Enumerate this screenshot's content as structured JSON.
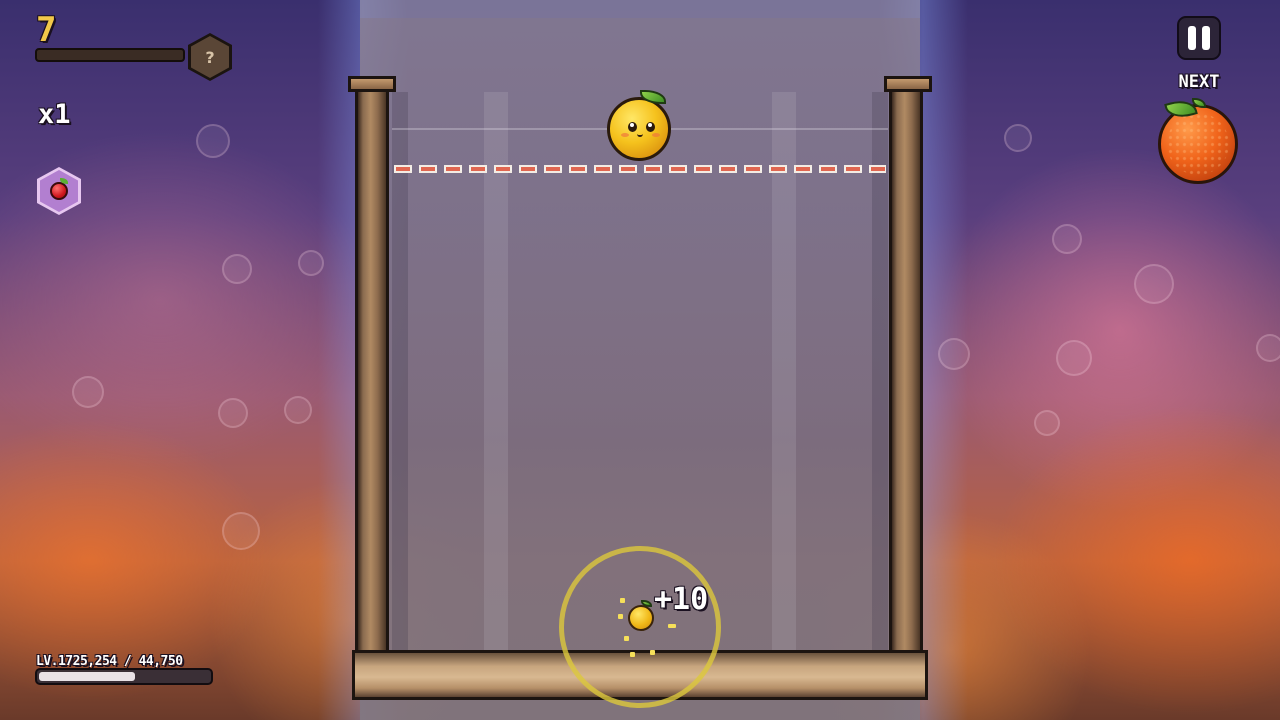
{
  "hud": {
    "score": "7",
    "score_progress": 0.0,
    "mystery_badge": "?",
    "combo": "x1",
    "powerup_icon": "apple-icon",
    "pause_icon": "pause-icon",
    "next_label": "NEXT",
    "next_fruit": "orange",
    "level_label": "LV.17",
    "level_xp": "25,254 / 44,750",
    "level_progress": 0.564
  },
  "board": {
    "current_fruit": "lemon",
    "merged_fruit": "lemon",
    "points_popup": "+10"
  },
  "colors": {
    "score_gold": "#f2c84a",
    "danger_line": "#e06650",
    "wood": "#b08a63",
    "ring": "#dcc83c"
  }
}
